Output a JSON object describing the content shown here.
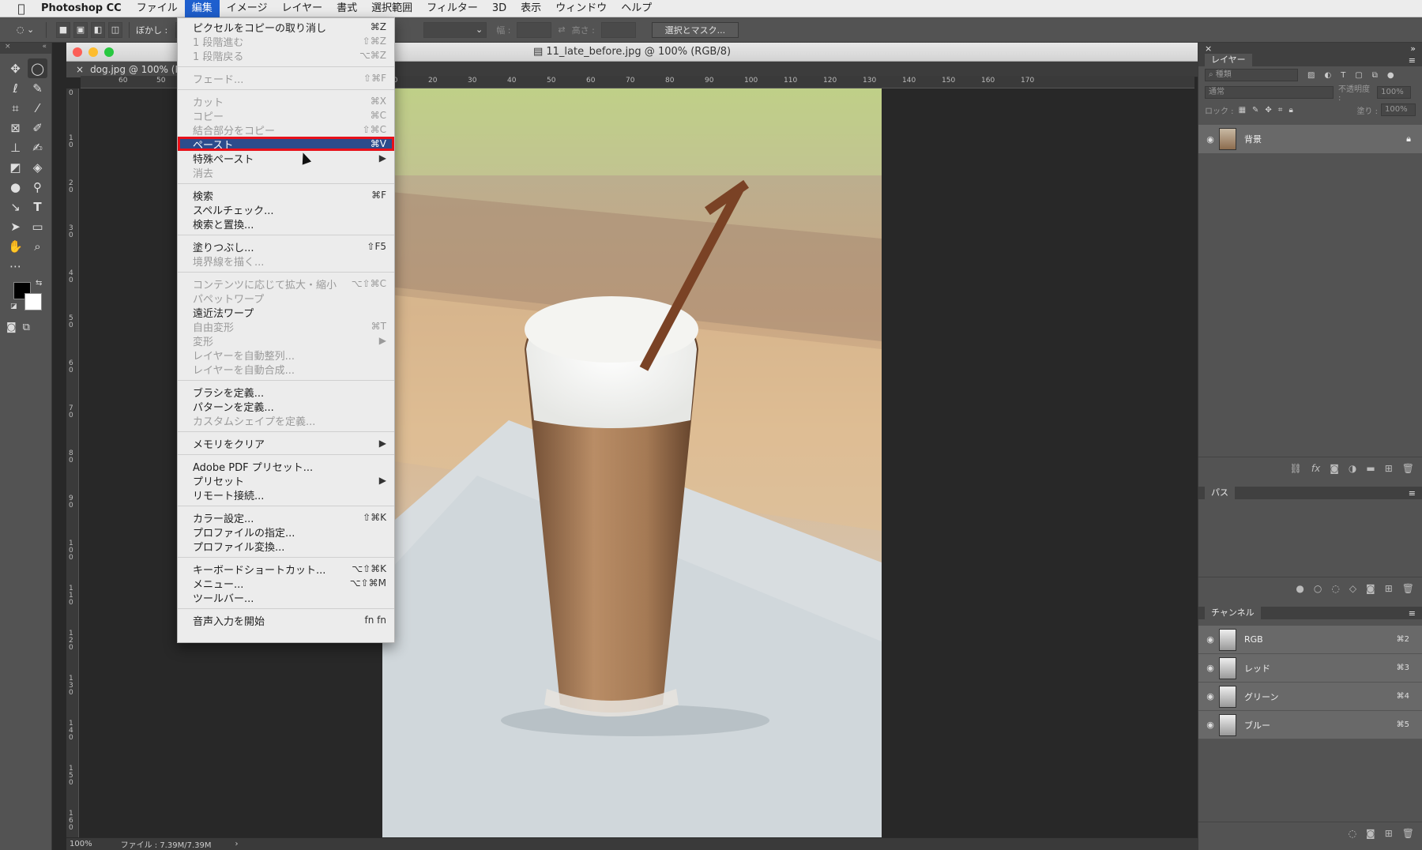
{
  "menubar": {
    "app_name": "Photoshop CC",
    "items": [
      "ファイル",
      "編集",
      "イメージ",
      "レイヤー",
      "書式",
      "選択範囲",
      "フィルター",
      "3D",
      "表示",
      "ウィンドウ",
      "ヘルプ"
    ],
    "active_index": 1
  },
  "options_bar": {
    "feather_label": "ぼかし :",
    "width_label": "幅 :",
    "height_label": "高さ :",
    "select_mask_button": "選択とマスク..."
  },
  "document": {
    "window_title": "11_late_before.jpg @ 100% (RGB/8)",
    "tab_title": "dog.jpg @ 100% (RG",
    "ruler_marks": [
      "60",
      "50",
      "10",
      "20",
      "30",
      "40",
      "50",
      "60",
      "70",
      "80",
      "90",
      "100",
      "110",
      "120",
      "130",
      "140",
      "150",
      "160",
      "170"
    ],
    "vruler_marks": [
      "0",
      "10",
      "20",
      "30",
      "40",
      "50",
      "60",
      "70",
      "80",
      "90",
      "100",
      "110",
      "120",
      "130",
      "140",
      "150",
      "160"
    ],
    "zoom": "100%",
    "file_info": "ファイル : 7.39M/7.39M"
  },
  "edit_menu": {
    "groups": [
      [
        {
          "label": "ピクセルをコピーの取り消し",
          "shortcut": "⌘Z",
          "disabled": false
        },
        {
          "label": "1 段階進む",
          "shortcut": "⇧⌘Z",
          "disabled": true
        },
        {
          "label": "1 段階戻る",
          "shortcut": "⌥⌘Z",
          "disabled": true
        }
      ],
      [
        {
          "label": "フェード...",
          "shortcut": "⇧⌘F",
          "disabled": true
        }
      ],
      [
        {
          "label": "カット",
          "shortcut": "⌘X",
          "disabled": true
        },
        {
          "label": "コピー",
          "shortcut": "⌘C",
          "disabled": true
        },
        {
          "label": "結合部分をコピー",
          "shortcut": "⇧⌘C",
          "disabled": true
        },
        {
          "label": "ペースト",
          "shortcut": "⌘V",
          "disabled": false,
          "highlighted": true
        },
        {
          "label": "特殊ペースト",
          "shortcut": "▶",
          "disabled": false
        },
        {
          "label": "消去",
          "shortcut": "",
          "disabled": true
        }
      ],
      [
        {
          "label": "検索",
          "shortcut": "⌘F",
          "disabled": false
        },
        {
          "label": "スペルチェック...",
          "shortcut": "",
          "disabled": false
        },
        {
          "label": "検索と置換...",
          "shortcut": "",
          "disabled": false
        }
      ],
      [
        {
          "label": "塗りつぶし...",
          "shortcut": "⇧F5",
          "disabled": false
        },
        {
          "label": "境界線を描く...",
          "shortcut": "",
          "disabled": true
        }
      ],
      [
        {
          "label": "コンテンツに応じて拡大・縮小",
          "shortcut": "⌥⇧⌘C",
          "disabled": true
        },
        {
          "label": "パペットワープ",
          "shortcut": "",
          "disabled": true
        },
        {
          "label": "遠近法ワープ",
          "shortcut": "",
          "disabled": false
        },
        {
          "label": "自由変形",
          "shortcut": "⌘T",
          "disabled": true
        },
        {
          "label": "変形",
          "shortcut": "▶",
          "disabled": true
        },
        {
          "label": "レイヤーを自動整列...",
          "shortcut": "",
          "disabled": true
        },
        {
          "label": "レイヤーを自動合成...",
          "shortcut": "",
          "disabled": true
        }
      ],
      [
        {
          "label": "ブラシを定義...",
          "shortcut": "",
          "disabled": false
        },
        {
          "label": "パターンを定義...",
          "shortcut": "",
          "disabled": false
        },
        {
          "label": "カスタムシェイプを定義...",
          "shortcut": "",
          "disabled": true
        }
      ],
      [
        {
          "label": "メモリをクリア",
          "shortcut": "▶",
          "disabled": false
        }
      ],
      [
        {
          "label": "Adobe PDF プリセット...",
          "shortcut": "",
          "disabled": false
        },
        {
          "label": "プリセット",
          "shortcut": "▶",
          "disabled": false
        },
        {
          "label": "リモート接続...",
          "shortcut": "",
          "disabled": false
        }
      ],
      [
        {
          "label": "カラー設定...",
          "shortcut": "⇧⌘K",
          "disabled": false
        },
        {
          "label": "プロファイルの指定...",
          "shortcut": "",
          "disabled": false
        },
        {
          "label": "プロファイル変換...",
          "shortcut": "",
          "disabled": false
        }
      ],
      [
        {
          "label": "キーボードショートカット...",
          "shortcut": "⌥⇧⌘K",
          "disabled": false
        },
        {
          "label": "メニュー...",
          "shortcut": "⌥⇧⌘M",
          "disabled": false
        },
        {
          "label": "ツールバー...",
          "shortcut": "",
          "disabled": false
        }
      ],
      [
        {
          "label": "音声入力を開始",
          "shortcut": "fn fn",
          "disabled": false
        }
      ]
    ]
  },
  "layers_panel": {
    "tab": "レイヤー",
    "filter_placeholder": "種類",
    "blend_mode": "通常",
    "opacity_label": "不透明度 :",
    "opacity_value": "100%",
    "lock_label": "ロック :",
    "fill_label": "塗り :",
    "fill_value": "100%",
    "layers": [
      {
        "name": "背景",
        "locked": true
      }
    ]
  },
  "paths_panel": {
    "tab": "パス"
  },
  "channels_panel": {
    "tab": "チャンネル",
    "channels": [
      {
        "name": "RGB",
        "shortcut": "⌘2"
      },
      {
        "name": "レッド",
        "shortcut": "⌘3"
      },
      {
        "name": "グリーン",
        "shortcut": "⌘4"
      },
      {
        "name": "ブルー",
        "shortcut": "⌘5"
      }
    ]
  },
  "colors": {
    "menu_highlight": "#2c4c8c",
    "highlight_outline": "#e8101a",
    "menubar_active": "#1e5fce"
  }
}
